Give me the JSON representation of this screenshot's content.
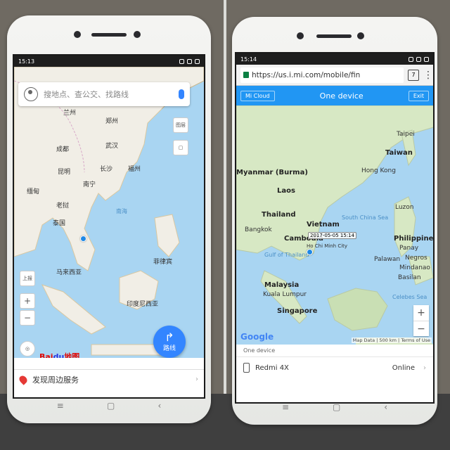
{
  "left_phone": {
    "status": {
      "time": "15:13"
    },
    "search": {
      "placeholder": "搜地点、查公交、找路线"
    },
    "side_buttons": {
      "layers": "图层",
      "download": "上报"
    },
    "route_button": {
      "label": "路线"
    },
    "logo": {
      "prefix": "Bai",
      "paw": "du",
      "suffix": "地图"
    },
    "nearby": {
      "label": "发现周边服务"
    },
    "map_labels": [
      {
        "text": "兰州"
      },
      {
        "text": "郑州"
      },
      {
        "text": "成都"
      },
      {
        "text": "武汉"
      },
      {
        "text": "昆明"
      },
      {
        "text": "长沙"
      },
      {
        "text": "福州"
      },
      {
        "text": "南宁"
      },
      {
        "text": "缅甸"
      },
      {
        "text": "老挝"
      },
      {
        "text": "泰国"
      },
      {
        "text": "南海"
      },
      {
        "text": "马来西亚"
      },
      {
        "text": "印度尼西亚"
      },
      {
        "text": "菲律宾"
      }
    ]
  },
  "right_phone": {
    "status": {
      "time": "15:14"
    },
    "browser": {
      "url": "https://us.i.mi.com/mobile/fin",
      "tabs": "7"
    },
    "header": {
      "left_button": "Mi Cloud",
      "title": "One device",
      "right_button": "Exit"
    },
    "map_labels": [
      {
        "text": "Taipei"
      },
      {
        "text": "Taiwan"
      },
      {
        "text": "Hong Kong"
      },
      {
        "text": "Myanmar (Burma)"
      },
      {
        "text": "Laos"
      },
      {
        "text": "Thailand"
      },
      {
        "text": "Vietnam"
      },
      {
        "text": "South China Sea"
      },
      {
        "text": "Luzon"
      },
      {
        "text": "Bangkok"
      },
      {
        "text": "Cambodia"
      },
      {
        "text": "Philippines"
      },
      {
        "text": "Panay"
      },
      {
        "text": "Gulf of Thailand"
      },
      {
        "text": "Palawan"
      },
      {
        "text": "Negros"
      },
      {
        "text": "Mindanao"
      },
      {
        "text": "Malaysia"
      },
      {
        "text": "Kuala Lumpur"
      },
      {
        "text": "Basilan"
      },
      {
        "text": "Singapore"
      },
      {
        "text": "Celebes Sea"
      },
      {
        "text": "Ho Chi Minh City"
      }
    ],
    "location_tag": "2017-05-05 15:14",
    "map_footer": {
      "data": "Map Data",
      "scale": "500 km",
      "terms": "Terms of Use"
    },
    "google": "Google",
    "device_panel": {
      "section": "One device",
      "device_name": "Redmi 4X",
      "status": "Online"
    }
  }
}
